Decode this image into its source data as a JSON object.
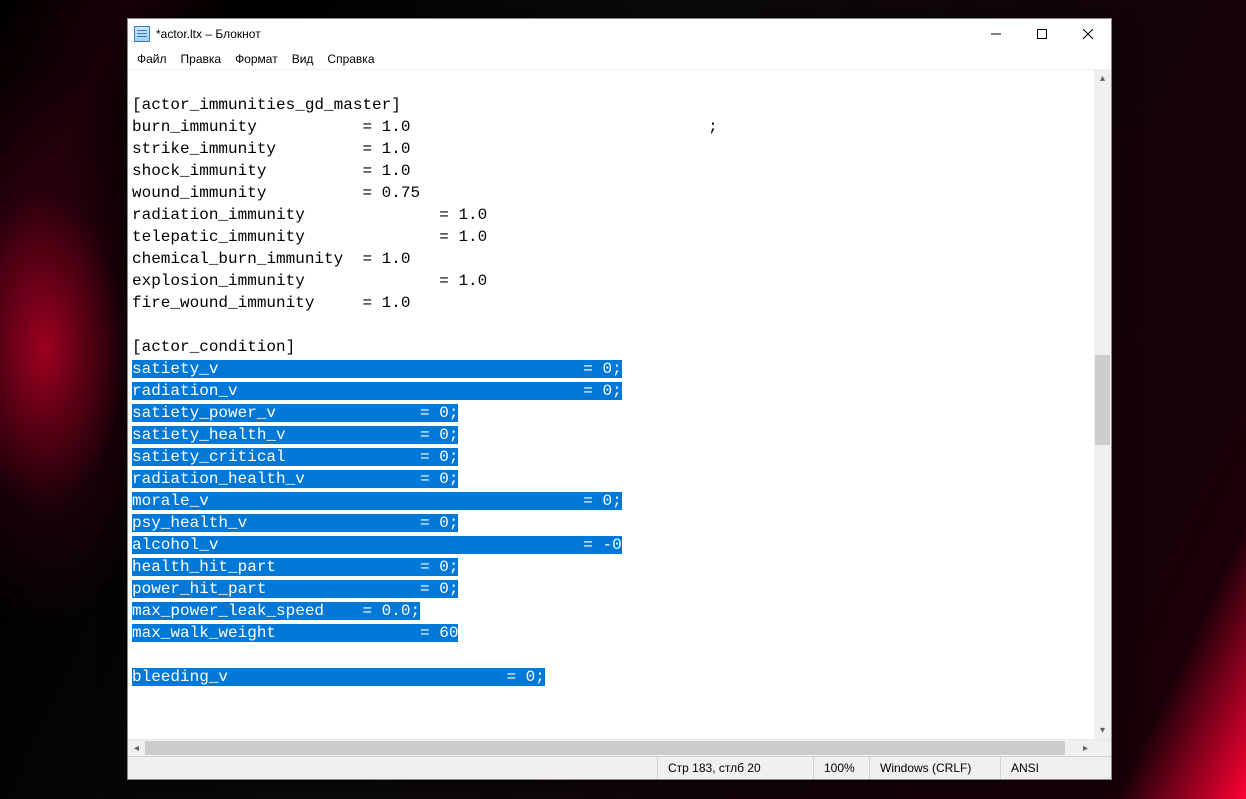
{
  "title": "*actor.ltx – Блокнот",
  "menu": {
    "file": "Файл",
    "edit": "Правка",
    "format": "Формат",
    "view": "Вид",
    "help": "Справка"
  },
  "content": {
    "blank0": "",
    "section1": "[actor_immunities_gd_master]",
    "l1": "burn_immunity           = 1.0                               ;",
    "l2": "strike_immunity         = 1.0",
    "l3": "shock_immunity          = 1.0",
    "l4": "wound_immunity          = 0.75",
    "l5": "radiation_immunity              = 1.0",
    "l6": "telepatic_immunity              = 1.0",
    "l7": "chemical_burn_immunity  = 1.0",
    "l8": "explosion_immunity              = 1.0",
    "l9": "fire_wound_immunity     = 1.0",
    "blank1": "",
    "section2": "[actor_condition]",
    "s1a": "satiety_v",
    "s1b": "                                      = 0;",
    "s2a": "radiation_v",
    "s2b": "                                    = 0;",
    "s3a": "satiety_power_v",
    "s3b": "               = 0;",
    "s4a": "satiety_health_v",
    "s4b": "              = 0;",
    "s5a": "satiety_critical",
    "s5b": "              = 0;",
    "s6a": "radiation_health_v",
    "s6b": "            = 0;",
    "s7a": "morale_v",
    "s7b": "                                       = 0;",
    "s8a": "psy_health_v",
    "s8b": "                  = 0;",
    "s9a": "alcohol_v",
    "s9b": "                                      = -0",
    "s10a": "health_hit_part",
    "s10b": "               = 0;",
    "s11a": "power_hit_part",
    "s11b": "                = 0;",
    "s12a": "max_power_leak_speed",
    "s12b": "    = 0.0;",
    "s13a": "max_walk_weight",
    "s13b": "               = 60",
    "blank2": "",
    "s14a": "bleeding_v",
    "s14b": "                             = 0;"
  },
  "status": {
    "position": "Стр 183, стлб 20",
    "zoom": "100%",
    "eol": "Windows (CRLF)",
    "encoding": "ANSI"
  }
}
